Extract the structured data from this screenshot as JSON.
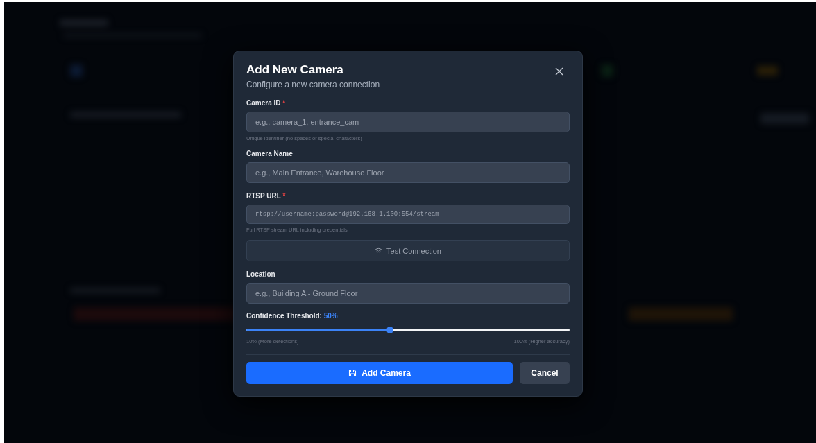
{
  "dialog": {
    "title": "Add New Camera",
    "subtitle": "Configure a new camera connection",
    "fields": [
      {
        "kind": "text",
        "label": "Camera ID",
        "required_mark": "*",
        "placeholder": "e.g., camera_1, entrance_cam",
        "help": "Unique identifier (no spaces or special characters)"
      },
      {
        "kind": "text",
        "label": "Camera Name",
        "placeholder": "e.g., Main Entrance, Warehouse Floor"
      },
      {
        "kind": "mono",
        "label": "RTSP URL",
        "required_mark": "*",
        "placeholder": "rtsp://username:password@192.168.1.100:554/stream",
        "help": "Full RTSP stream URL including credentials"
      },
      {
        "kind": "action",
        "label": "Test Connection"
      },
      {
        "kind": "text",
        "label": "Location",
        "placeholder": "e.g., Building A - Ground Floor"
      }
    ],
    "threshold": {
      "label": "Confidence Threshold:",
      "reading": "50%",
      "level": 0.445,
      "min_label": "10% (More detections)",
      "max_label": "100% (Higher accuracy)"
    },
    "buttons": [
      {
        "kind": "primary",
        "label": "Add Camera"
      },
      {
        "kind": "secondary",
        "label": "Cancel"
      }
    ]
  }
}
